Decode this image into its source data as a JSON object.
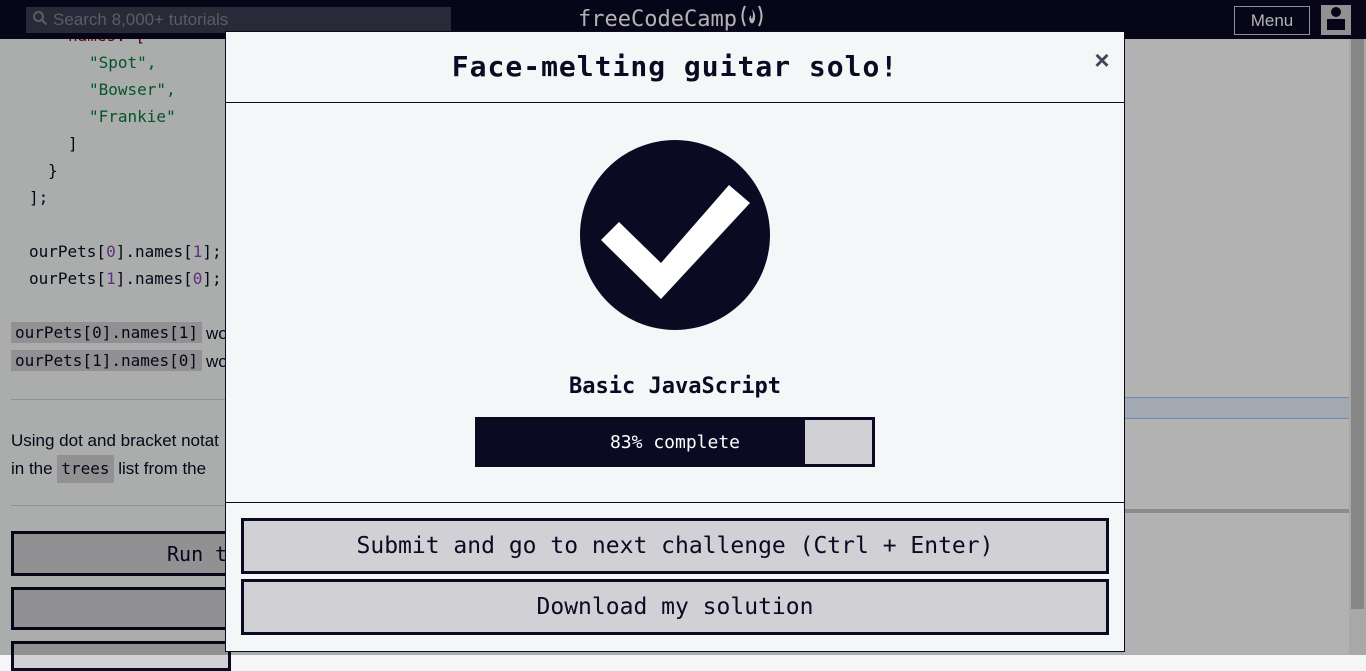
{
  "navbar": {
    "search_placeholder": "Search 8,000+ tutorials",
    "logo_text": "freeCodeCamp",
    "menu_label": "Menu"
  },
  "code": {
    "line0": "names: [",
    "str1": "\"Spot\",",
    "str2": "\"Bowser\",",
    "str3": "\"Frankie\"",
    "line4": "]",
    "line5": "}",
    "line6": "];",
    "l7_pre": "ourPets[",
    "l7_n1": "0",
    "l7_mid": "].names[",
    "l7_n2": "1",
    "l7_post": "];",
    "l8_pre": "ourPets[",
    "l8_n1": "1",
    "l8_mid": "].names[",
    "l8_n2": "0",
    "l8_post": "];"
  },
  "lesson": {
    "inline1": "ourPets[0].names[1]",
    "inline1_after": "wo",
    "inline2": "ourPets[1].names[0]",
    "inline2_after": "wo",
    "desc_line1": "Using dot and bracket notat",
    "desc_line2_pre": "in the",
    "desc_code": "trees",
    "desc_line2_post": "list from the",
    "run_label": "Run t"
  },
  "modal": {
    "title": "Face-melting guitar solo!",
    "close": "×",
    "block_name": "Basic JavaScript",
    "progress_percent": 83,
    "progress_text": "83% complete",
    "submit_label": "Submit and go to next challenge (Ctrl + Enter)",
    "download_label": "Download my solution"
  },
  "colors": {
    "primary": "#0a0a23",
    "button_bg": "#d0d0d5",
    "modal_bg": "#f5f6f7",
    "string": "#067a3c",
    "number": "#8b47b4"
  }
}
